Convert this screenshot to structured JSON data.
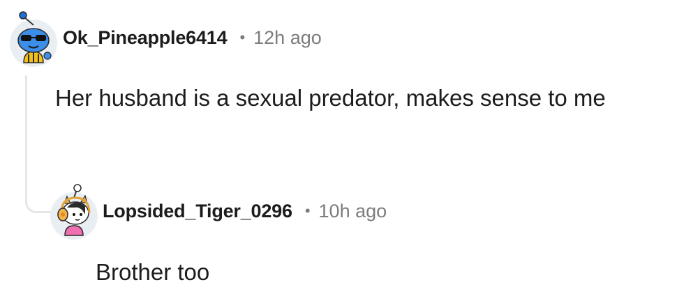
{
  "comments": [
    {
      "username": "Ok_Pineapple6414",
      "separator": "•",
      "time": "12h ago",
      "text": "Her husband is a sexual predator, makes sense to me",
      "avatar": "snoo-avatar-sunglasses-icon"
    },
    {
      "username": "Lopsided_Tiger_0296",
      "separator": "•",
      "time": "10h ago",
      "text": "Brother too",
      "avatar": "snoo-avatar-headphones-icon"
    }
  ],
  "colors": {
    "text": "#1c1c1c",
    "meta": "#7c7c7c",
    "thread_line": "#e6e6e6"
  }
}
